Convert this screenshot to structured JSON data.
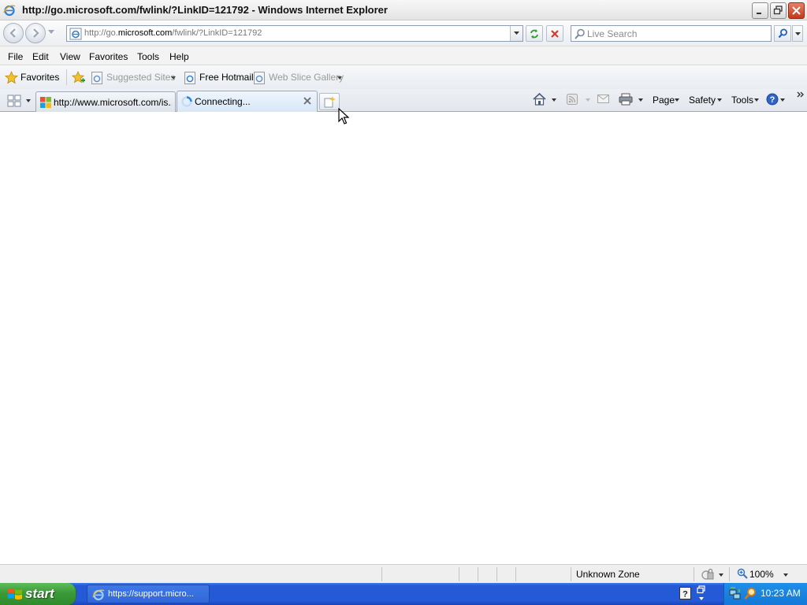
{
  "window": {
    "title": "http://go.microsoft.com/fwlink/?LinkID=121792 - Windows Internet Explorer"
  },
  "address_bar": {
    "url_prefix": "http://go.",
    "url_host": "microsoft.com",
    "url_suffix": "/fwlink/?LinkID=121792",
    "search_placeholder": "Live Search"
  },
  "menu": {
    "items": [
      "File",
      "Edit",
      "View",
      "Favorites",
      "Tools",
      "Help"
    ]
  },
  "favorites_bar": {
    "favorites_label": "Favorites",
    "links": [
      {
        "label": "Suggested Sites",
        "dimmed": true
      },
      {
        "label": "Free Hotmail",
        "dimmed": false
      },
      {
        "label": "Web Slice Gallery",
        "dimmed": true
      }
    ]
  },
  "tabs": [
    {
      "label": "http://www.microsoft.com/is...",
      "active": false
    },
    {
      "label": "Connecting...",
      "active": true
    }
  ],
  "command_bar": {
    "page_label": "Page",
    "safety_label": "Safety",
    "tools_label": "Tools"
  },
  "status_bar": {
    "zone": "Unknown Zone",
    "zoom": "100%"
  },
  "taskbar": {
    "start_label": "start",
    "window_item": "https://support.micro...",
    "clock": "10:23 AM"
  },
  "colors": {
    "taskbar_blue": "#245ad8",
    "start_green": "#3b9a38",
    "close_red": "#c4381c",
    "tray_blue": "#1478d8"
  }
}
